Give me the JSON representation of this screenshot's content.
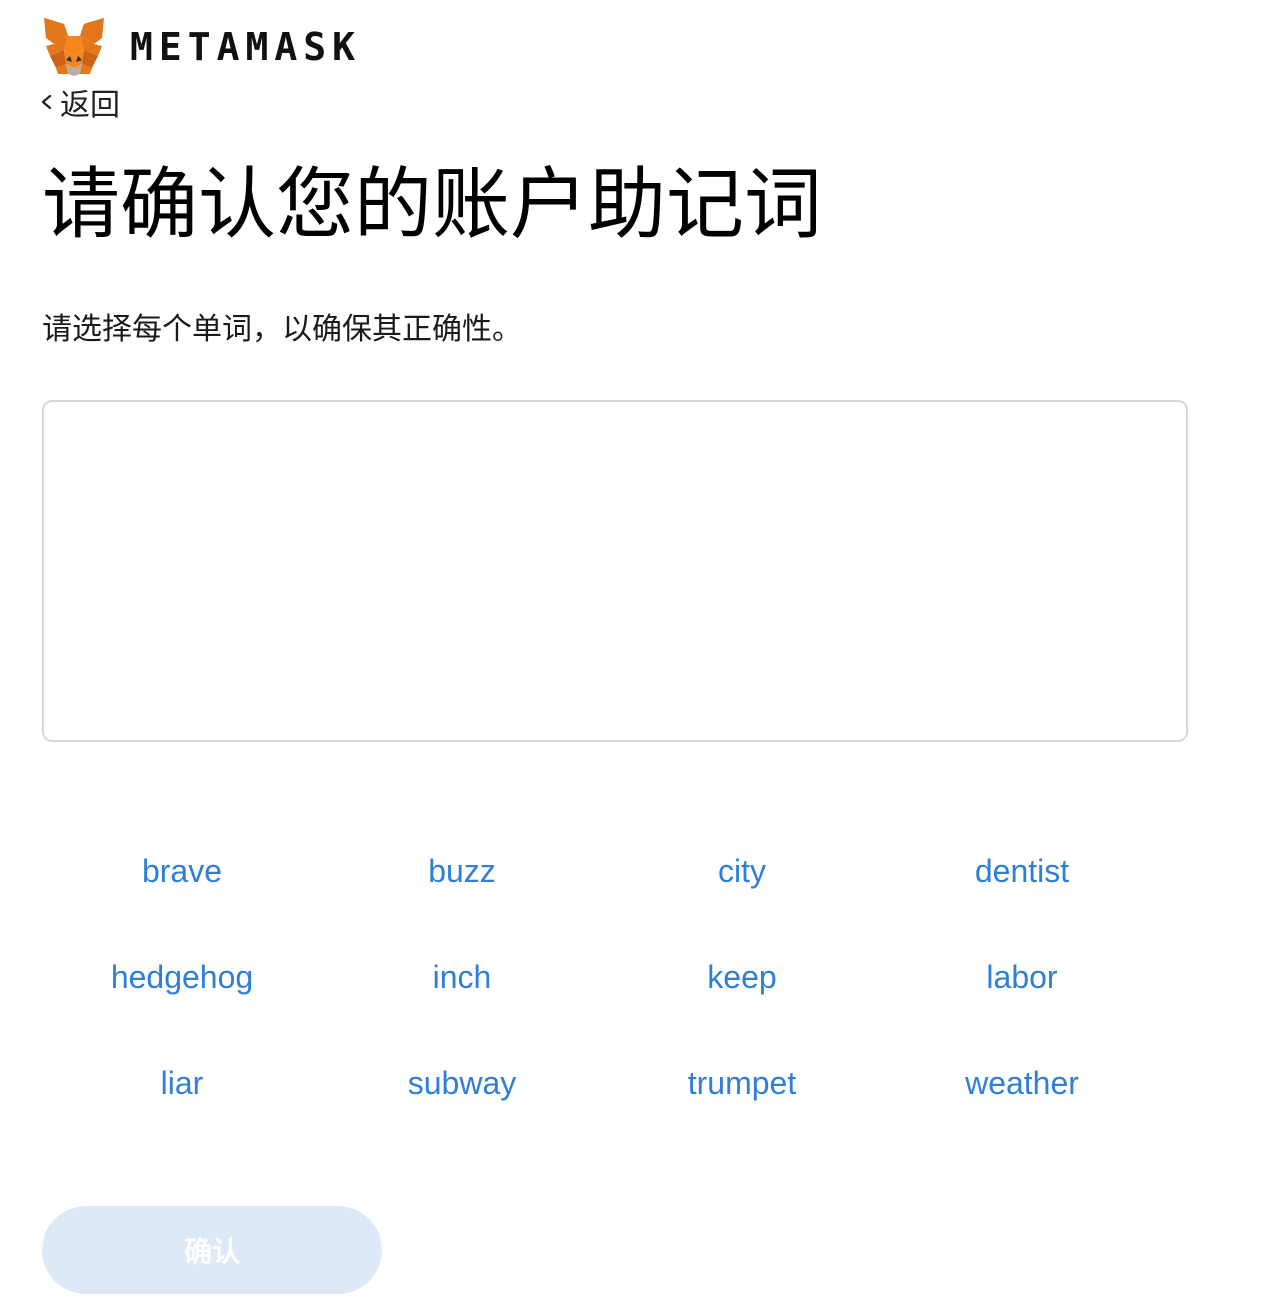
{
  "header": {
    "brand": "METAMASK",
    "logo_icon": "metamask-fox-icon"
  },
  "nav": {
    "back_label": "返回",
    "back_icon": "chevron-left-icon"
  },
  "main": {
    "title": "请确认您的账户助记词",
    "instruction": "请选择每个单词，以确保其正确性。",
    "selected_words": [],
    "word_options": [
      "brave",
      "buzz",
      "city",
      "dentist",
      "hedgehog",
      "inch",
      "keep",
      "labor",
      "liar",
      "subway",
      "trumpet",
      "weather"
    ],
    "confirm_label": "确认",
    "confirm_enabled": false
  },
  "colors": {
    "word_link": "#2f7fd6",
    "confirm_disabled_bg": "#dde9f7",
    "box_border": "#d8d8d8"
  }
}
